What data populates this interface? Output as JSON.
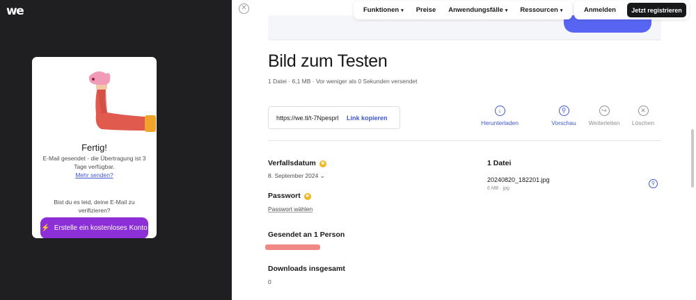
{
  "brand": {
    "logo_text": "we"
  },
  "panel": {
    "title": "Fertig!",
    "message": "E-Mail gesendet - die Übertragung ist 3 Tage verfügbar.",
    "more_link": "Mehr senden?",
    "question": "Bist du es leid, deine E-Mail zu verifizieren?",
    "cta": "Erstelle ein kostenloses Konto"
  },
  "nav": {
    "items": [
      "Funktionen",
      "Preise",
      "Anwendungsfälle",
      "Ressourcen"
    ],
    "login": "Anmelden",
    "register": "Jetzt registrieren"
  },
  "transfer": {
    "title": "Bild zum Testen",
    "meta": "1 Datei · 6,1 MB · Vor weniger als 0 Sekunden versendet",
    "link_url": "https://we.tl/t-7Npesprl",
    "copy_label": "Link kopieren",
    "actions": [
      "Herunterladen",
      "Vorschau",
      "Weiterleiten",
      "Löschen"
    ]
  },
  "details": {
    "expiry_label": "Verfallsdatum",
    "expiry_value": "8. September 2024",
    "password_label": "Passwort",
    "password_value": "Passwort wählen",
    "sent_label": "Gesendet an 1 Person",
    "downloads_label": "Downloads insgesamt",
    "downloads_value": "0"
  },
  "files": {
    "title": "1 Datei",
    "name": "20240820_182201.jpg",
    "meta": "6 MB · jpg"
  },
  "colors": {
    "accent": "#3d57d6",
    "cta": "#8c2fd6",
    "premium": "#f3b51a",
    "dark_bg": "#1f1f21"
  }
}
